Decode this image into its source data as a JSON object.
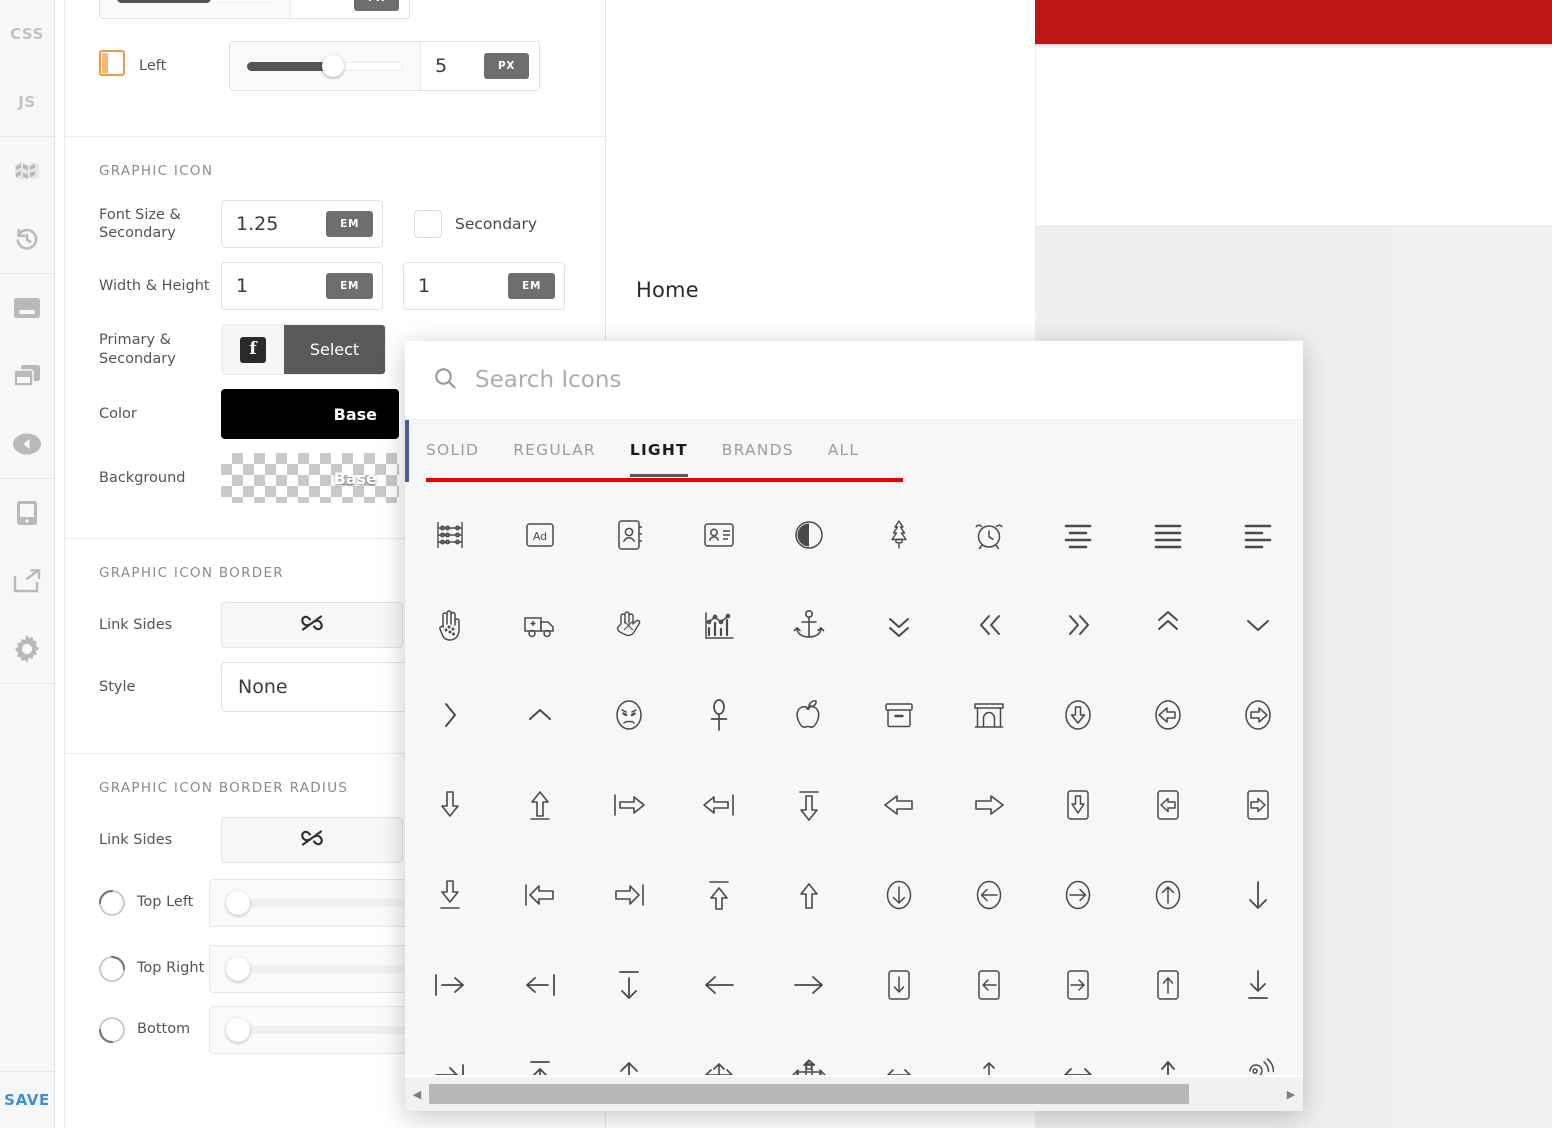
{
  "app": {
    "rail": {
      "items": [
        {
          "label": "CSS",
          "name": "rail-css",
          "kind": "text"
        },
        {
          "label": "JS",
          "name": "rail-js",
          "kind": "text"
        },
        {
          "label": "",
          "name": "rail-selector-icon",
          "kind": "icon",
          "icon": "selector-icon"
        },
        {
          "label": "",
          "name": "rail-history-icon",
          "kind": "icon",
          "icon": "history-icon"
        },
        {
          "label": "",
          "name": "rail-header-icon",
          "kind": "icon",
          "icon": "header-block-icon"
        },
        {
          "label": "",
          "name": "rail-layers-icon",
          "kind": "icon",
          "icon": "layers-icon"
        },
        {
          "label": "",
          "name": "rail-collapse-icon",
          "kind": "icon",
          "icon": "collapse-left-icon"
        },
        {
          "label": "",
          "name": "rail-responsive-icon",
          "kind": "icon",
          "icon": "tablet-icon"
        },
        {
          "label": "",
          "name": "rail-preview-icon",
          "kind": "icon",
          "icon": "external-link-icon"
        },
        {
          "label": "",
          "name": "rail-settings-icon",
          "kind": "icon",
          "icon": "gear-icon"
        }
      ],
      "save_label": "SAVE"
    },
    "panel": {
      "spacing_row": {
        "label": "Left",
        "value": "5",
        "unit": "PX",
        "slider_percent": 55
      },
      "graphic_icon": {
        "title": "GRAPHIC ICON",
        "rows": {
          "font_size": {
            "label": "Font Size & Secondary",
            "value": "1.25",
            "unit": "EM",
            "checkbox_label": "Secondary",
            "checked": false
          },
          "width_height": {
            "label": "Width & Height",
            "width_value": "1",
            "width_unit": "EM",
            "height_value": "1",
            "height_unit": "EM"
          },
          "primary_secondary": {
            "label": "Primary & Secondary",
            "icon": "facebook-icon",
            "button_label": "Select"
          },
          "color": {
            "label": "Color",
            "swatch_label": "Base",
            "swatch_color": "#000000"
          },
          "background": {
            "label": "Background",
            "swatch_label": "Base",
            "swatch_color": "transparent"
          }
        }
      },
      "graphic_icon_border": {
        "title": "GRAPHIC ICON BORDER",
        "link_sides_label": "Link Sides",
        "link_sides_icon": "broken-link-icon",
        "style_label": "Style",
        "style_value": "None"
      },
      "graphic_icon_border_radius": {
        "title": "GRAPHIC ICON BORDER RADIUS",
        "link_sides_label": "Link Sides",
        "link_sides_icon": "broken-link-icon",
        "corners": [
          {
            "label": "Top Left",
            "corner_icon": "corner-top-left-icon",
            "slider_percent": 3
          },
          {
            "label": "Top Right",
            "corner_icon": "corner-top-right-icon",
            "slider_percent": 3
          },
          {
            "label": "Bottom",
            "corner_icon": "corner-bottom-icon",
            "slider_percent": 3
          }
        ]
      }
    },
    "preview": {
      "home_label": "Home",
      "accent_bar_color": "#bf1717"
    },
    "icon_picker": {
      "search_placeholder": "Search Icons",
      "search_value": "",
      "search_icon": "search-icon",
      "tabs": [
        {
          "label": "SOLID",
          "active": false
        },
        {
          "label": "REGULAR",
          "active": false
        },
        {
          "label": "LIGHT",
          "active": true
        },
        {
          "label": "BRANDS",
          "active": false
        },
        {
          "label": "ALL",
          "active": false
        }
      ],
      "underline_color": "#ee0000",
      "rows": [
        [
          "abacus-icon",
          "ad-icon",
          "address-book-icon",
          "address-card-icon",
          "adjust-icon",
          "air-freshener-icon",
          "alarm-clock-icon",
          "align-center-icon",
          "align-justify-icon",
          "align-left-icon"
        ],
        [
          "allergies-hand-icon",
          "ambulance-icon",
          "american-sign-language-icon",
          "analytics-icon",
          "anchor-icon",
          "angle-double-down-icon",
          "angle-double-left-icon",
          "angle-double-right-icon",
          "angle-double-up-icon",
          "angle-down-icon"
        ],
        [
          "angle-right-icon",
          "angle-up-icon",
          "angry-icon",
          "ankh-icon",
          "apple-alt-icon",
          "archive-icon",
          "archway-icon",
          "arrow-alt-circle-down-icon",
          "arrow-alt-circle-left-icon",
          "arrow-alt-circle-right-icon"
        ],
        [
          "arrow-alt-down-icon",
          "arrow-alt-from-bottom-icon",
          "arrow-alt-from-left-icon",
          "arrow-alt-from-right-icon",
          "arrow-alt-from-top-icon",
          "arrow-alt-left-icon",
          "arrow-alt-right-icon",
          "arrow-alt-square-down-icon",
          "arrow-alt-square-left-icon",
          "arrow-alt-square-right-icon"
        ],
        [
          "arrow-alt-to-bottom-icon",
          "arrow-alt-to-left-icon",
          "arrow-alt-to-right-icon",
          "arrow-alt-to-top-icon",
          "arrow-alt-up-icon",
          "arrow-circle-down-icon",
          "arrow-circle-left-icon",
          "arrow-circle-right-icon",
          "arrow-circle-up-icon",
          "arrow-down-icon"
        ],
        [
          "arrow-from-left-icon",
          "arrow-from-right-icon",
          "arrow-from-top-icon",
          "arrow-left-icon",
          "arrow-right-icon",
          "arrow-square-down-icon",
          "arrow-square-left-icon",
          "arrow-square-right-icon",
          "arrow-square-up-icon",
          "arrow-to-bottom-icon"
        ],
        [
          "arrow-to-right-icon",
          "arrow-to-top-icon",
          "arrow-up-icon",
          "arrows-alt-h-icon",
          "arrows-alt-icon",
          "arrows-h-icon",
          "arrows-v-icon",
          "arrows-left-right-icon",
          "arrow-up-long-icon",
          "assistive-listening-icon"
        ]
      ],
      "scrollbar": {
        "left_arrow": "◀",
        "right_arrow": "▶"
      }
    }
  }
}
